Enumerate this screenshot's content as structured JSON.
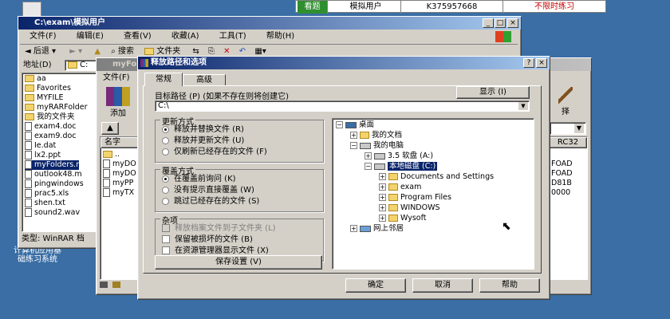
{
  "desktop": {
    "icon_label_line1": "计算机应用基",
    "icon_label_line2": "础练习系统"
  },
  "status_bar": {
    "tag": "看题",
    "user": "模拟用户",
    "id": "K375957668",
    "mode": "不限时练习"
  },
  "explorer": {
    "title": "C:\\exam\\模拟用户",
    "menu": [
      "文件(F)",
      "编辑(E)",
      "查看(V)",
      "收藏(A)",
      "工具(T)",
      "帮助(H)"
    ],
    "toolbar": {
      "back": "后退",
      "search": "搜索",
      "folders": "文件夹"
    },
    "address_label": "地址(D)",
    "address_value": "C:",
    "files": [
      "aa",
      "Favorites",
      "MYFILE",
      "myRARFolder",
      "我的文件夹",
      "exam4.doc",
      "exam9.doc",
      "Ie.dat",
      "lx2.ppt",
      "myFolders.r",
      "outlook48.m",
      "pingwindows",
      "prac5.xls",
      "shen.txt",
      "sound2.wav"
    ],
    "status_text": "类型: WinRAR 档"
  },
  "winrar": {
    "title": "myFolders.rar",
    "menu": "文件(F)",
    "add_label": "添加",
    "column_name": "名字",
    "entries": [
      "..",
      "myDO",
      "myDO",
      "myPP",
      "myTX"
    ]
  },
  "right_panel": {
    "select_label": "择",
    "header": "RC32",
    "values": [
      "FOAD",
      "FOAD",
      "D81B",
      "0000"
    ]
  },
  "dialog": {
    "title": "释放路径和选项",
    "tabs": [
      "常规",
      "高级"
    ],
    "target_label": "目标路径 (P) (如果不存在则将创建它)",
    "show_button": "显示 (I)",
    "path_value": "C:\\",
    "update": {
      "label": "更新方式",
      "options": [
        "释放并替换文件 (R)",
        "释放并更新文件 (U)",
        "仅刷新已经存在的文件 (F)"
      ]
    },
    "overwrite": {
      "label": "覆盖方式",
      "options": [
        "在覆盖前询问 (K)",
        "没有提示直接覆盖 (W)",
        "跳过已经存在的文件 (S)"
      ]
    },
    "misc": {
      "label": "杂项",
      "options": [
        "释放档案文件到子文件夹 (L)",
        "保留被损坏的文件 (B)",
        "在资源管理器显示文件 (X)"
      ]
    },
    "save_button": "保存设置 (V)",
    "tree": {
      "desktop": "桌面",
      "my_docs": "我的文档",
      "my_computer": "我的电脑",
      "floppy": "3.5 软盘 (A:)",
      "local_disk": "本地磁盘 (C:)",
      "folders": [
        "Documents and Settings",
        "exam",
        "Program Files",
        "WINDOWS",
        "Wysoft"
      ],
      "network": "网上邻居"
    },
    "ok": "确定",
    "cancel": "取消",
    "help": "帮助"
  }
}
